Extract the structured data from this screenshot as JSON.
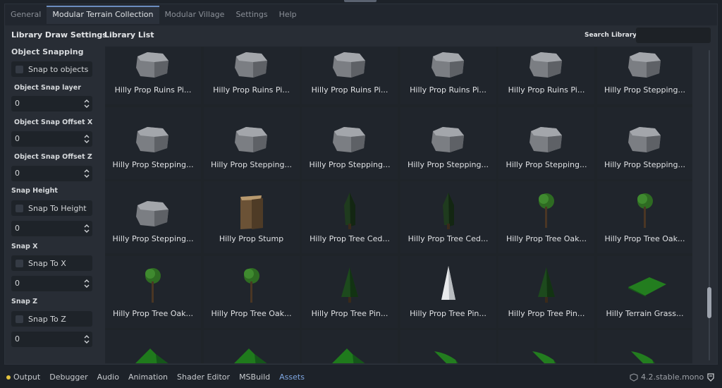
{
  "tabs": [
    "General",
    "Modular Terrain Collection",
    "Modular Village",
    "Settings",
    "Help"
  ],
  "active_tab": 1,
  "settings": {
    "title": "Library Draw Settings",
    "object_snapping_heading": "Object Snapping",
    "snap_to_objects_label": "Snap to objects",
    "object_snap_layer_label": "Object Snap layer",
    "object_snap_layer_value": "0",
    "object_snap_offset_x_label": "Object Snap Offset X",
    "object_snap_offset_x_value": "0",
    "object_snap_offset_z_label": "Object Snap Offset Z",
    "object_snap_offset_z_value": "0",
    "snap_height_heading": "Snap Height",
    "snap_to_height_label": "Snap To Height",
    "snap_height_value": "0",
    "snap_x_heading": "Snap X",
    "snap_to_x_label": "Snap To X",
    "snap_x_value": "0",
    "snap_z_heading": "Snap Z",
    "snap_to_z_label": "Snap To Z",
    "snap_z_value": "0"
  },
  "library": {
    "title": "Library List",
    "search_label": "Search Library",
    "search_value": "",
    "items": [
      {
        "label": "Hilly Prop Ruins Pi...",
        "icon": "rock-icon"
      },
      {
        "label": "Hilly Prop Ruins Pi...",
        "icon": "rock-icon"
      },
      {
        "label": "Hilly Prop Ruins Pi...",
        "icon": "rock-icon"
      },
      {
        "label": "Hilly Prop Ruins Pi...",
        "icon": "rock-icon"
      },
      {
        "label": "Hilly Prop Ruins Pi...",
        "icon": "rock-icon"
      },
      {
        "label": "Hilly Prop Stepping...",
        "icon": "rock-icon"
      },
      {
        "label": "Hilly Prop Stepping...",
        "icon": "rock-icon"
      },
      {
        "label": "Hilly Prop Stepping...",
        "icon": "rock-icon"
      },
      {
        "label": "Hilly Prop Stepping...",
        "icon": "rock-icon"
      },
      {
        "label": "Hilly Prop Stepping...",
        "icon": "rock-icon"
      },
      {
        "label": "Hilly Prop Stepping...",
        "icon": "rock-icon"
      },
      {
        "label": "Hilly Prop Stepping...",
        "icon": "rock-icon"
      },
      {
        "label": "Hilly Prop Stepping...",
        "icon": "rock-icon"
      },
      {
        "label": "Hilly Prop Stump",
        "icon": "stump-icon"
      },
      {
        "label": "Hilly Prop Tree Ced...",
        "icon": "cedar-tree-icon"
      },
      {
        "label": "Hilly Prop Tree Ced...",
        "icon": "cedar-tree-icon"
      },
      {
        "label": "Hilly Prop Tree Oak...",
        "icon": "oak-tree-icon"
      },
      {
        "label": "Hilly Prop Tree Oak...",
        "icon": "oak-tree-icon"
      },
      {
        "label": "Hilly Prop Tree Oak...",
        "icon": "oak-tree-icon"
      },
      {
        "label": "Hilly Prop Tree Oak...",
        "icon": "oak-tree-icon"
      },
      {
        "label": "Hilly Prop Tree Pin...",
        "icon": "pine-tree-icon"
      },
      {
        "label": "Hilly Prop Tree Pin...",
        "icon": "white-pine-tree-icon"
      },
      {
        "label": "Hilly Prop Tree Pin...",
        "icon": "pine-tree-icon"
      },
      {
        "label": "Hilly Terrain Grass...",
        "icon": "grass-tile-icon"
      },
      {
        "label": "",
        "icon": "grass-patch-icon"
      },
      {
        "label": "",
        "icon": "grass-patch-icon"
      },
      {
        "label": "",
        "icon": "grass-patch-icon"
      },
      {
        "label": "",
        "icon": "grass-strip-icon"
      },
      {
        "label": "",
        "icon": "grass-strip-icon"
      },
      {
        "label": "",
        "icon": "grass-strip-icon"
      }
    ]
  },
  "bottom_bar": {
    "items": [
      "Output",
      "Debugger",
      "Audio",
      "Animation",
      "Shader Editor",
      "MSBuild",
      "Assets"
    ],
    "active_item": "Assets",
    "version": "4.2.stable.mono"
  },
  "colors": {
    "accent": "#6c8dbf",
    "active_bottom": "#7ea6e0",
    "output_dot": "#e3c33f"
  }
}
